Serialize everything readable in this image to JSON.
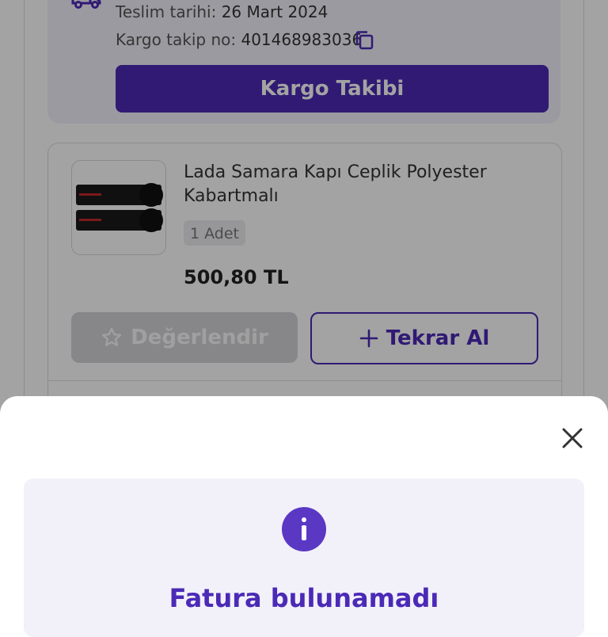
{
  "shipping": {
    "delivery_label": "Teslim tarihi:",
    "delivery_date": "26 Mart 2024",
    "tracking_label": "Kargo takip no:",
    "tracking_number": "401468983036",
    "track_button": "Kargo Takibi"
  },
  "product": {
    "name": "Lada Samara Kapı Ceplik Polyester Kabartmalı",
    "quantity": "1 Adet",
    "price": "500,80 TL",
    "rate_button": "Değerlendir",
    "reorder_button": "Tekrar Al"
  },
  "sheet": {
    "title": "Fatura bulunamadı"
  },
  "colors": {
    "accent": "#4b2ab6",
    "info_icon": "#5b38c4",
    "panel_bg": "#f3f1fc"
  },
  "icons": [
    "truck-icon",
    "copy-icon",
    "star-icon",
    "plus-icon",
    "close-icon",
    "info-icon"
  ]
}
